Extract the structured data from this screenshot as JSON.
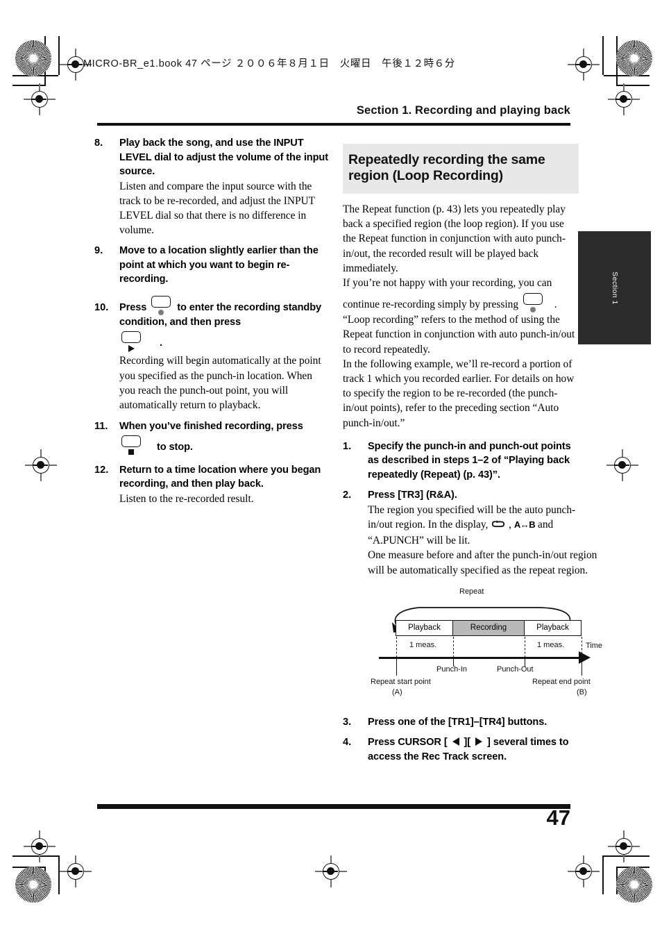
{
  "slug": "MICRO-BR_e1.book 47 ページ ２００６年８月１日　火曜日　午後１２時６分",
  "running_head": "Section 1. Recording and playing back",
  "side_tab": "Section 1",
  "folio": "47",
  "left_column": {
    "steps": [
      {
        "num": "8.",
        "bold": "Play back the song, and use the INPUT LEVEL dial to adjust the volume of the input source.",
        "body": "Listen and compare the input source with the track to be re-recorded, and adjust the INPUT LEVEL dial so that there is no difference in volume."
      },
      {
        "num": "9.",
        "bold": "Move to a location slightly earlier than the point at which you want to begin re-recording.",
        "body": ""
      },
      {
        "num": "10.",
        "bold_a": "Press",
        "bold_b": "to enter the recording standby condition, and then press",
        "bold_c": ".",
        "body": "Recording will begin automatically at the point you specified as the punch-in location. When you reach the punch-out point, you will automatically return to playback."
      },
      {
        "num": "11.",
        "bold_a": "When you’ve finished recording, press",
        "bold_b": "to stop.",
        "body": ""
      },
      {
        "num": "12.",
        "bold": "Return to a time location where you began recording, and then play back.",
        "body": "Listen to the re-recorded result."
      }
    ]
  },
  "right_column": {
    "heading": "Repeatedly recording the same region (Loop Recording)",
    "intro_1": "The Repeat function (p. 43) lets you repeatedly play back a specified region (the loop region). If you use the Repeat function in conjunction with auto punch-in/out, the recorded result will be played back immediately.",
    "intro_2": "If you’re not happy with your recording, you can",
    "intro_3_a": "continue re-recording simply by pressing",
    "intro_3_b": ".",
    "intro_4": "“Loop recording” refers to the method of using the Repeat function in conjunction with auto punch-in/out to record repeatedly.",
    "intro_5": "In the following example, we’ll re-record a portion of track 1 which you recorded earlier. For details on how to specify the region to be re-recorded (the punch-in/out points), refer to the preceding section “Auto punch-in/out.”",
    "steps": [
      {
        "num": "1.",
        "bold": "Specify the punch-in and punch-out points as described in steps 1–2 of “Playing back repeatedly (Repeat) (p. 43)”.",
        "body": ""
      },
      {
        "num": "2.",
        "bold": "Press [TR3] (R&A).",
        "body_a": "The region you specified will be the auto punch-in/out region. In the display,",
        "body_comma": ",",
        "body_ab_suffix": "and “A.PUNCH” will be lit.",
        "body_b": "One measure before and after the punch-in/out region will be automatically specified as the repeat region.",
        "ab_label": "A↔B"
      },
      {
        "num": "3.",
        "bold": "Press one of the [TR1]–[TR4] buttons.",
        "body": ""
      },
      {
        "num": "4.",
        "bold_a": "Press CURSOR [",
        "bold_b": "][",
        "bold_c": "] several times to access the Rec Track screen.",
        "body": ""
      }
    ]
  },
  "figure": {
    "title": "Repeat",
    "bands": [
      {
        "label": "Playback",
        "type": "playback"
      },
      {
        "label": "Recording",
        "type": "recording"
      },
      {
        "label": "Playback",
        "type": "playback"
      }
    ],
    "measure_left": "1 meas.",
    "measure_right": "1 meas.",
    "time_label": "Time",
    "punch_in": "Punch-In",
    "punch_out": "Punch-Out",
    "repeat_start": "Repeat start point",
    "repeat_start_id": "(A)",
    "repeat_end": "Repeat end point",
    "repeat_end_id": "(B)"
  },
  "colors": {
    "recording_fill": "#b9b9b9",
    "heading_bg": "#e8e8e8",
    "tab_bg": "#2b2b2b"
  }
}
